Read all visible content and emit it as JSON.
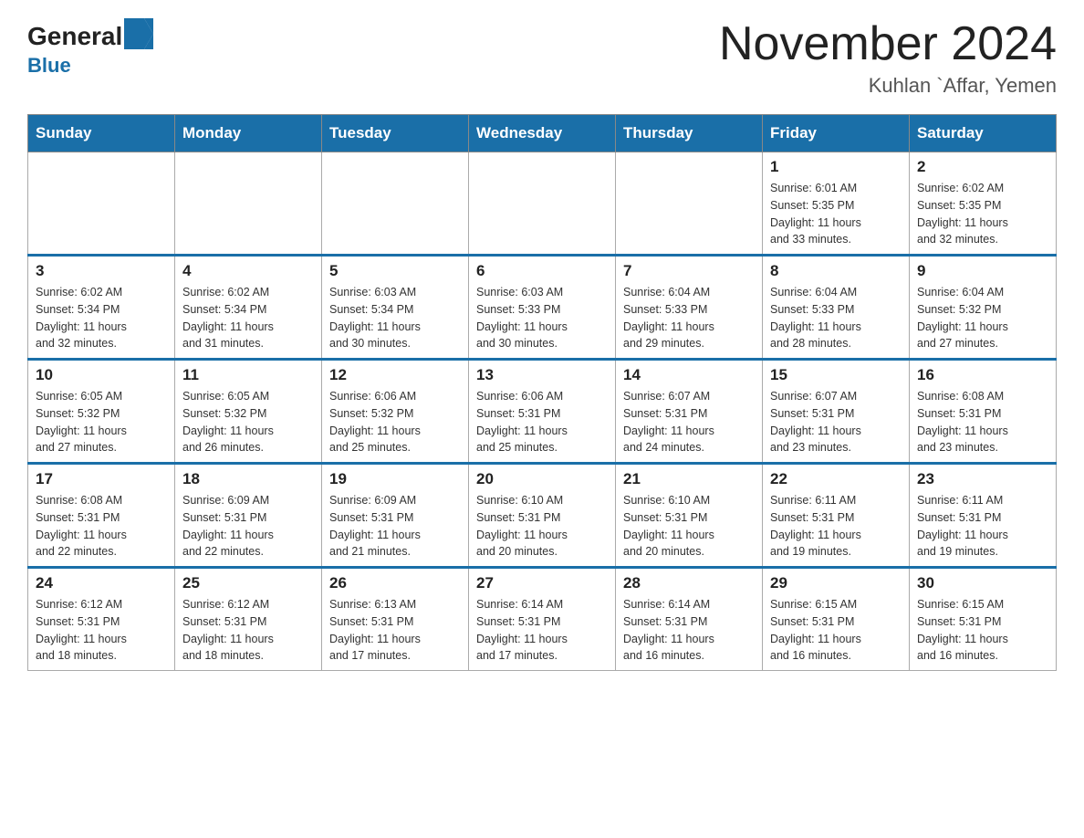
{
  "header": {
    "logo_general": "General",
    "logo_blue": "Blue",
    "title": "November 2024",
    "subtitle": "Kuhlan `Affar, Yemen"
  },
  "days_of_week": [
    "Sunday",
    "Monday",
    "Tuesday",
    "Wednesday",
    "Thursday",
    "Friday",
    "Saturday"
  ],
  "weeks": [
    {
      "days": [
        {
          "num": "",
          "info": ""
        },
        {
          "num": "",
          "info": ""
        },
        {
          "num": "",
          "info": ""
        },
        {
          "num": "",
          "info": ""
        },
        {
          "num": "",
          "info": ""
        },
        {
          "num": "1",
          "info": "Sunrise: 6:01 AM\nSunset: 5:35 PM\nDaylight: 11 hours\nand 33 minutes."
        },
        {
          "num": "2",
          "info": "Sunrise: 6:02 AM\nSunset: 5:35 PM\nDaylight: 11 hours\nand 32 minutes."
        }
      ]
    },
    {
      "days": [
        {
          "num": "3",
          "info": "Sunrise: 6:02 AM\nSunset: 5:34 PM\nDaylight: 11 hours\nand 32 minutes."
        },
        {
          "num": "4",
          "info": "Sunrise: 6:02 AM\nSunset: 5:34 PM\nDaylight: 11 hours\nand 31 minutes."
        },
        {
          "num": "5",
          "info": "Sunrise: 6:03 AM\nSunset: 5:34 PM\nDaylight: 11 hours\nand 30 minutes."
        },
        {
          "num": "6",
          "info": "Sunrise: 6:03 AM\nSunset: 5:33 PM\nDaylight: 11 hours\nand 30 minutes."
        },
        {
          "num": "7",
          "info": "Sunrise: 6:04 AM\nSunset: 5:33 PM\nDaylight: 11 hours\nand 29 minutes."
        },
        {
          "num": "8",
          "info": "Sunrise: 6:04 AM\nSunset: 5:33 PM\nDaylight: 11 hours\nand 28 minutes."
        },
        {
          "num": "9",
          "info": "Sunrise: 6:04 AM\nSunset: 5:32 PM\nDaylight: 11 hours\nand 27 minutes."
        }
      ]
    },
    {
      "days": [
        {
          "num": "10",
          "info": "Sunrise: 6:05 AM\nSunset: 5:32 PM\nDaylight: 11 hours\nand 27 minutes."
        },
        {
          "num": "11",
          "info": "Sunrise: 6:05 AM\nSunset: 5:32 PM\nDaylight: 11 hours\nand 26 minutes."
        },
        {
          "num": "12",
          "info": "Sunrise: 6:06 AM\nSunset: 5:32 PM\nDaylight: 11 hours\nand 25 minutes."
        },
        {
          "num": "13",
          "info": "Sunrise: 6:06 AM\nSunset: 5:31 PM\nDaylight: 11 hours\nand 25 minutes."
        },
        {
          "num": "14",
          "info": "Sunrise: 6:07 AM\nSunset: 5:31 PM\nDaylight: 11 hours\nand 24 minutes."
        },
        {
          "num": "15",
          "info": "Sunrise: 6:07 AM\nSunset: 5:31 PM\nDaylight: 11 hours\nand 23 minutes."
        },
        {
          "num": "16",
          "info": "Sunrise: 6:08 AM\nSunset: 5:31 PM\nDaylight: 11 hours\nand 23 minutes."
        }
      ]
    },
    {
      "days": [
        {
          "num": "17",
          "info": "Sunrise: 6:08 AM\nSunset: 5:31 PM\nDaylight: 11 hours\nand 22 minutes."
        },
        {
          "num": "18",
          "info": "Sunrise: 6:09 AM\nSunset: 5:31 PM\nDaylight: 11 hours\nand 22 minutes."
        },
        {
          "num": "19",
          "info": "Sunrise: 6:09 AM\nSunset: 5:31 PM\nDaylight: 11 hours\nand 21 minutes."
        },
        {
          "num": "20",
          "info": "Sunrise: 6:10 AM\nSunset: 5:31 PM\nDaylight: 11 hours\nand 20 minutes."
        },
        {
          "num": "21",
          "info": "Sunrise: 6:10 AM\nSunset: 5:31 PM\nDaylight: 11 hours\nand 20 minutes."
        },
        {
          "num": "22",
          "info": "Sunrise: 6:11 AM\nSunset: 5:31 PM\nDaylight: 11 hours\nand 19 minutes."
        },
        {
          "num": "23",
          "info": "Sunrise: 6:11 AM\nSunset: 5:31 PM\nDaylight: 11 hours\nand 19 minutes."
        }
      ]
    },
    {
      "days": [
        {
          "num": "24",
          "info": "Sunrise: 6:12 AM\nSunset: 5:31 PM\nDaylight: 11 hours\nand 18 minutes."
        },
        {
          "num": "25",
          "info": "Sunrise: 6:12 AM\nSunset: 5:31 PM\nDaylight: 11 hours\nand 18 minutes."
        },
        {
          "num": "26",
          "info": "Sunrise: 6:13 AM\nSunset: 5:31 PM\nDaylight: 11 hours\nand 17 minutes."
        },
        {
          "num": "27",
          "info": "Sunrise: 6:14 AM\nSunset: 5:31 PM\nDaylight: 11 hours\nand 17 minutes."
        },
        {
          "num": "28",
          "info": "Sunrise: 6:14 AM\nSunset: 5:31 PM\nDaylight: 11 hours\nand 16 minutes."
        },
        {
          "num": "29",
          "info": "Sunrise: 6:15 AM\nSunset: 5:31 PM\nDaylight: 11 hours\nand 16 minutes."
        },
        {
          "num": "30",
          "info": "Sunrise: 6:15 AM\nSunset: 5:31 PM\nDaylight: 11 hours\nand 16 minutes."
        }
      ]
    }
  ]
}
